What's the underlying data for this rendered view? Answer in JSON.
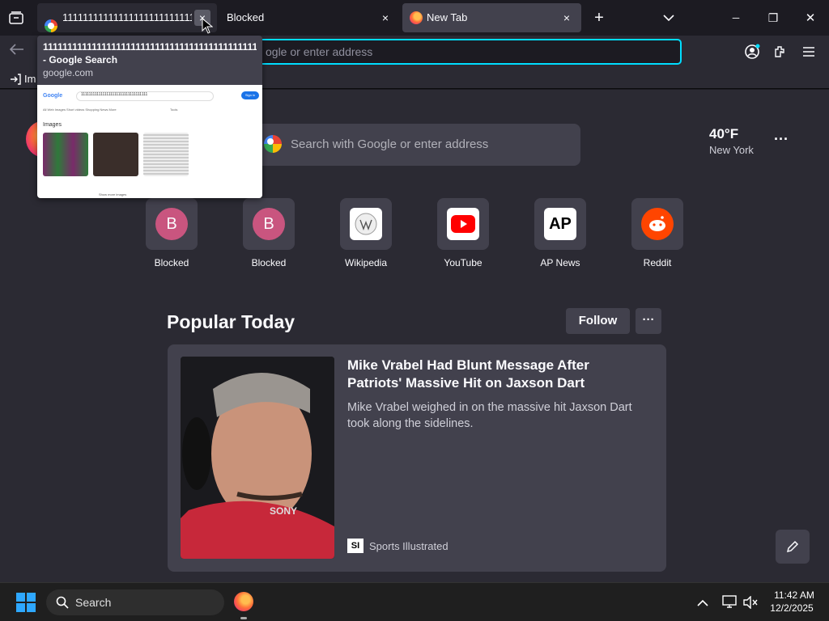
{
  "tabs": [
    {
      "label": "1111111111111111111111111111111111",
      "favicon": "google-icon",
      "close": "×"
    },
    {
      "label": "Blocked",
      "close": "×"
    },
    {
      "label": "New Tab",
      "favicon": "firefox-icon",
      "close": "×"
    }
  ],
  "tab_controls": {
    "new_tab": "+",
    "list_tabs": "⌄"
  },
  "window_controls": {
    "minimize": "─",
    "maximize": "❐",
    "close": "✕"
  },
  "tooltip": {
    "title_line1": "111111111111111111111111111111111111111111111111111111",
    "title_line2": "- Google Search",
    "url": "google.com",
    "preview": {
      "logo": "Google",
      "query": "1111111111111111111111111111111111",
      "tabs": "All  Web  Images  Short videos  Shopping  News  More",
      "tools": "Tools",
      "sign_in": "Sign in",
      "section": "Images",
      "show_more": "Show more images"
    }
  },
  "urlbar": {
    "placeholder": "Search with Google or enter address",
    "visible_placeholder": "ogle or enter address"
  },
  "bookmarks": {
    "import_label": "Im"
  },
  "newtab": {
    "search_placeholder": "Search with Google or enter address",
    "weather": {
      "temp": "40°F",
      "location": "New York"
    },
    "weather_menu": "···",
    "shortcuts": [
      {
        "label": "Blocked",
        "icon": "B"
      },
      {
        "label": "Blocked",
        "icon": "B"
      },
      {
        "label": "Wikipedia",
        "icon": "wikipedia-icon"
      },
      {
        "label": "YouTube",
        "icon": "youtube-icon"
      },
      {
        "label": "AP News",
        "icon": "AP"
      },
      {
        "label": "Reddit",
        "icon": "reddit-icon"
      }
    ],
    "popular": {
      "heading": "Popular Today",
      "follow": "Follow",
      "menu": "···"
    },
    "story": {
      "title": "Mike Vrabel Had Blunt Message After Patriots' Massive Hit on Jaxson Dart",
      "excerpt": "Mike Vrabel weighed in on the massive hit Jaxson Dart took along the sidelines.",
      "source": "Sports Illustrated",
      "source_logo": "SI",
      "image_text": "SONY"
    }
  },
  "taskbar": {
    "search_placeholder": "Search",
    "time": "11:42 AM",
    "date": "12/2/2025"
  },
  "colors": {
    "accent": "#00ddff",
    "bg_dark": "#1c1b22",
    "bg": "#2b2a33",
    "surface": "#42414d",
    "blocked_tile": "#c9557f",
    "youtube_red": "#ff0000",
    "reddit_orange": "#ff4500"
  }
}
